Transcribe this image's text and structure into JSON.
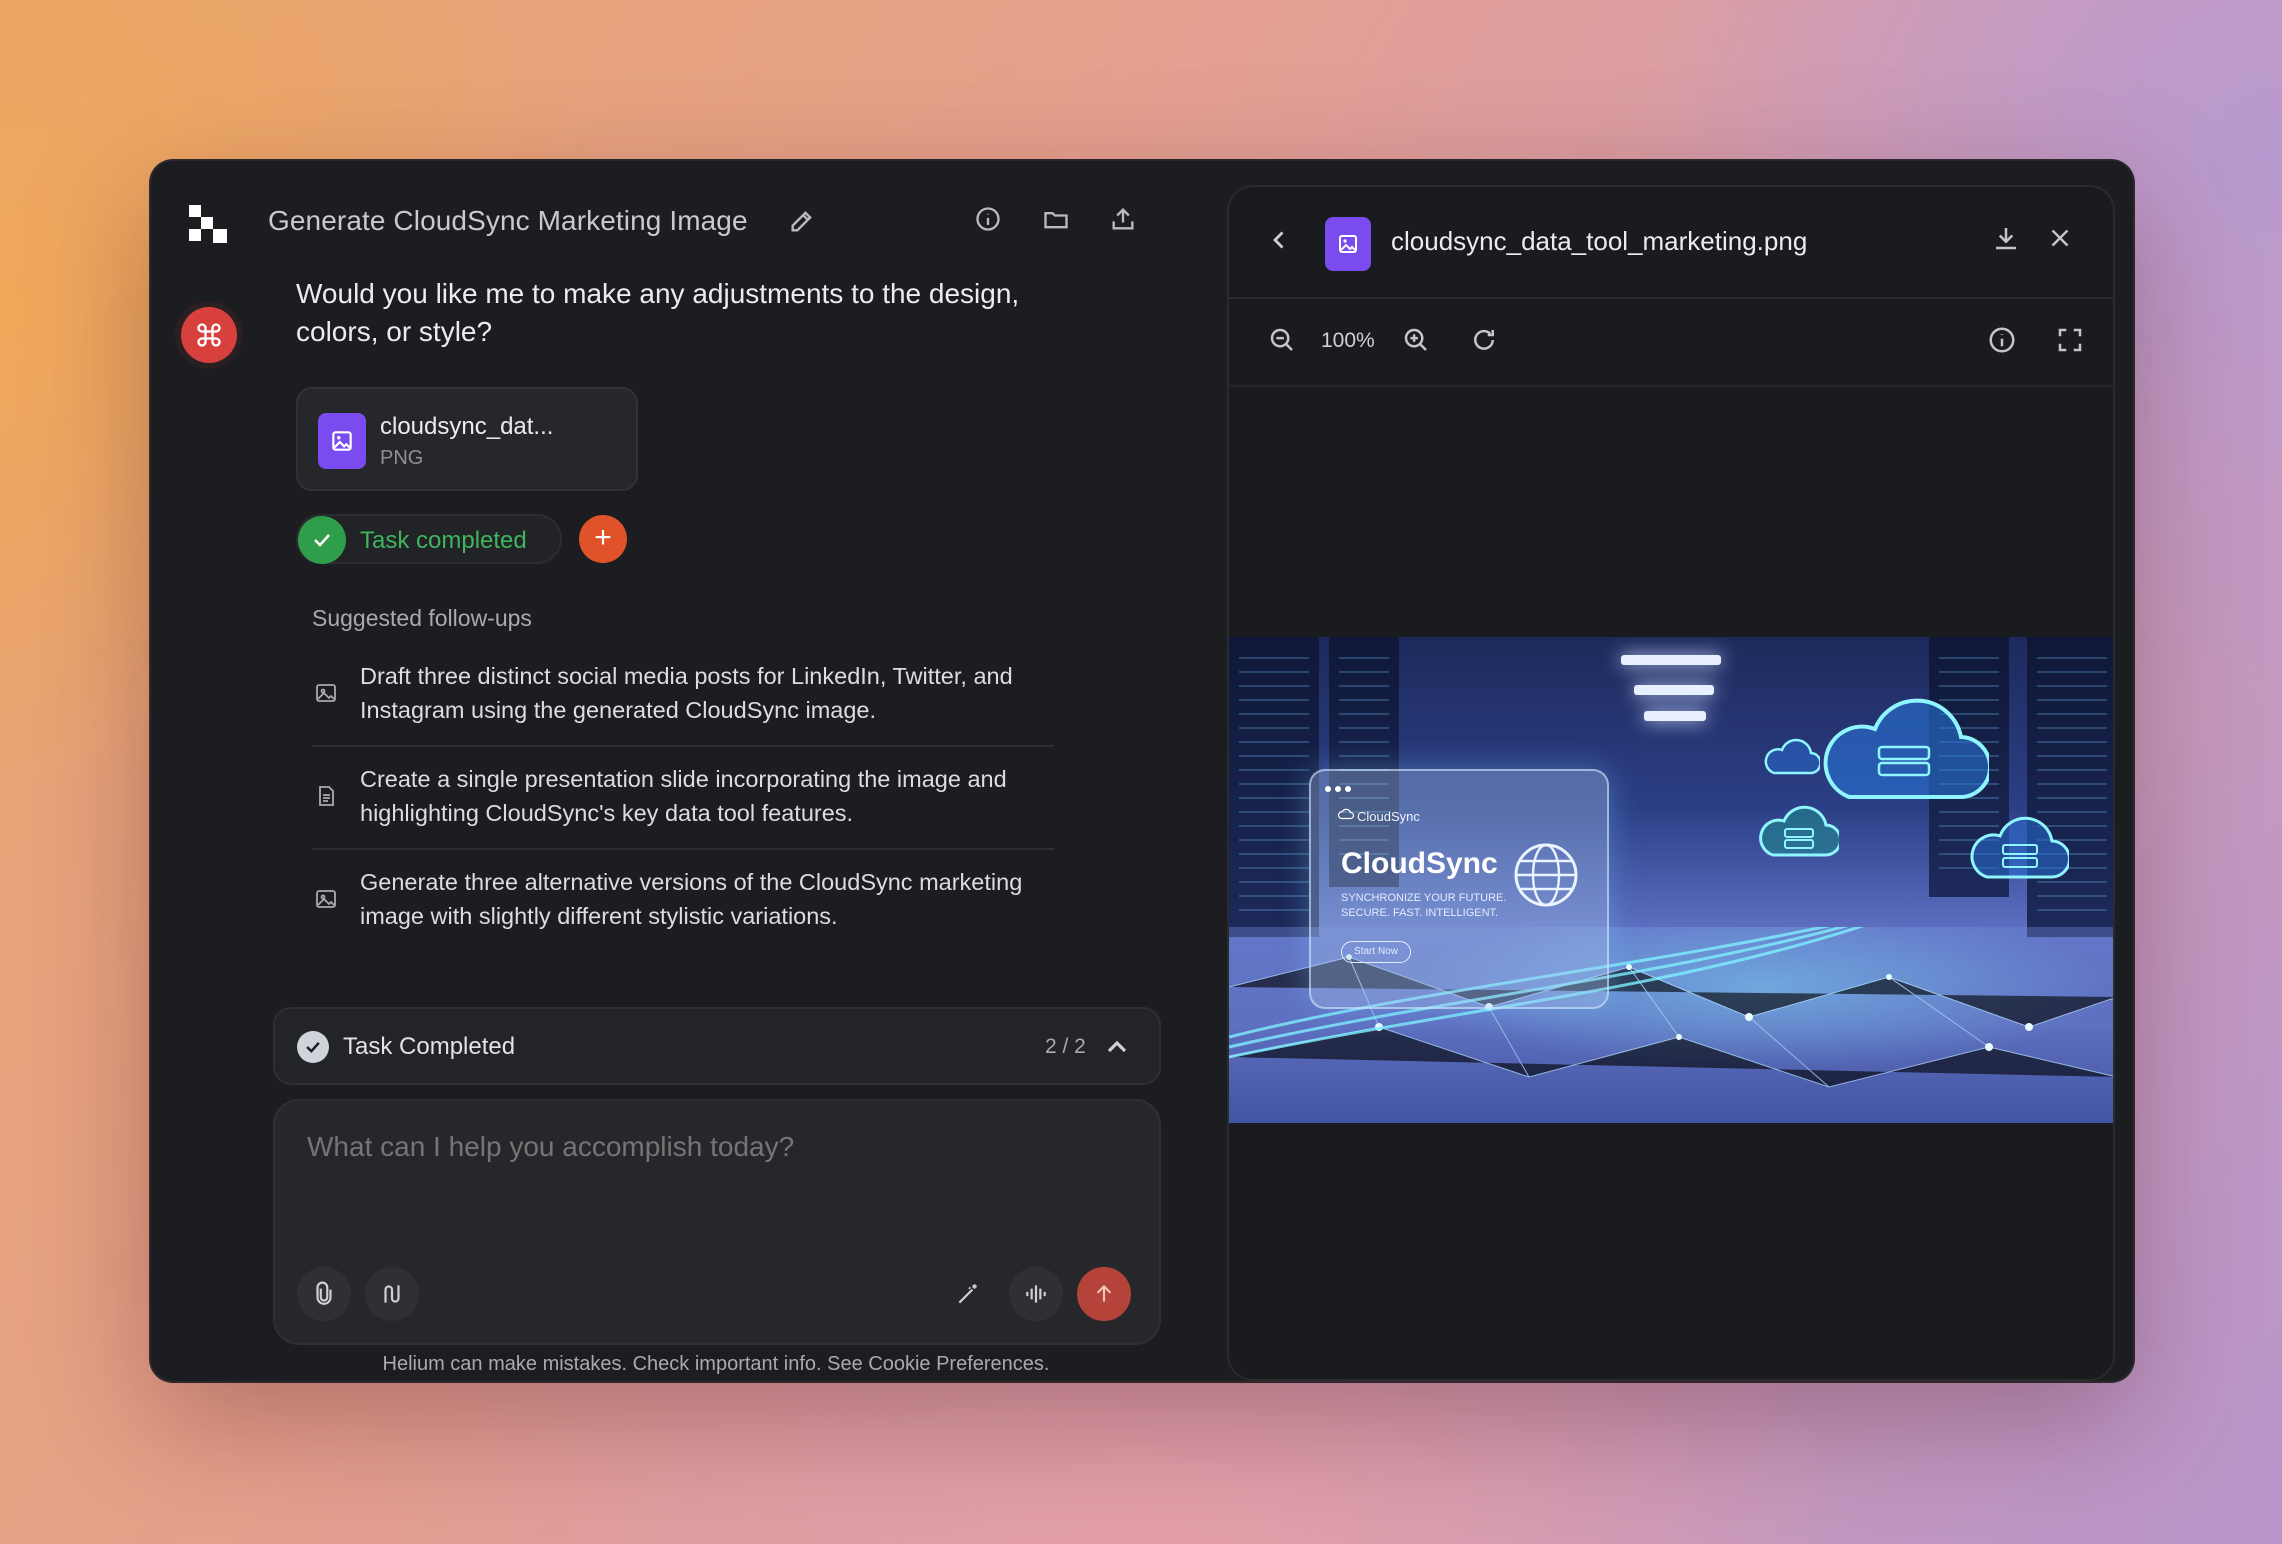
{
  "header": {
    "title": "Generate CloudSync Marketing Image"
  },
  "conversation": {
    "question": "Would you like me to make any adjustments to the design, colors, or style?",
    "attachment": {
      "name": "cloudsync_dat...",
      "type": "PNG"
    },
    "task_status": "Task completed"
  },
  "followups": {
    "title": "Suggested follow-ups",
    "items": [
      {
        "icon": "image-icon",
        "text": "Draft three distinct social media posts for LinkedIn, Twitter, and Instagram using the generated CloudSync image."
      },
      {
        "icon": "document-icon",
        "text": "Create a single presentation slide incorporating the image and highlighting CloudSync's key data tool features."
      },
      {
        "icon": "image-icon",
        "text": "Generate three alternative versions of the CloudSync marketing image with slightly different stylistic variations."
      }
    ]
  },
  "task_bar": {
    "label": "Task Completed",
    "count": "2 / 2"
  },
  "composer": {
    "placeholder": "What can I help you accomplish today?"
  },
  "disclaimer": "Helium can make mistakes. Check important info. See Cookie Preferences.",
  "preview": {
    "filename": "cloudsync_data_tool_marketing.png",
    "zoom": "100%",
    "image": {
      "brand_small": "CloudSync",
      "brand": "CloudSync",
      "tagline": "SYNCHRONIZE YOUR FUTURE. SECURE. FAST. INTELLIGENT.",
      "button": "Start Now"
    }
  },
  "colors": {
    "accent_orange": "#e0532a",
    "success_green": "#2e9e4a",
    "file_purple": "#7a4cf0",
    "avatar_red": "#d8403d"
  }
}
